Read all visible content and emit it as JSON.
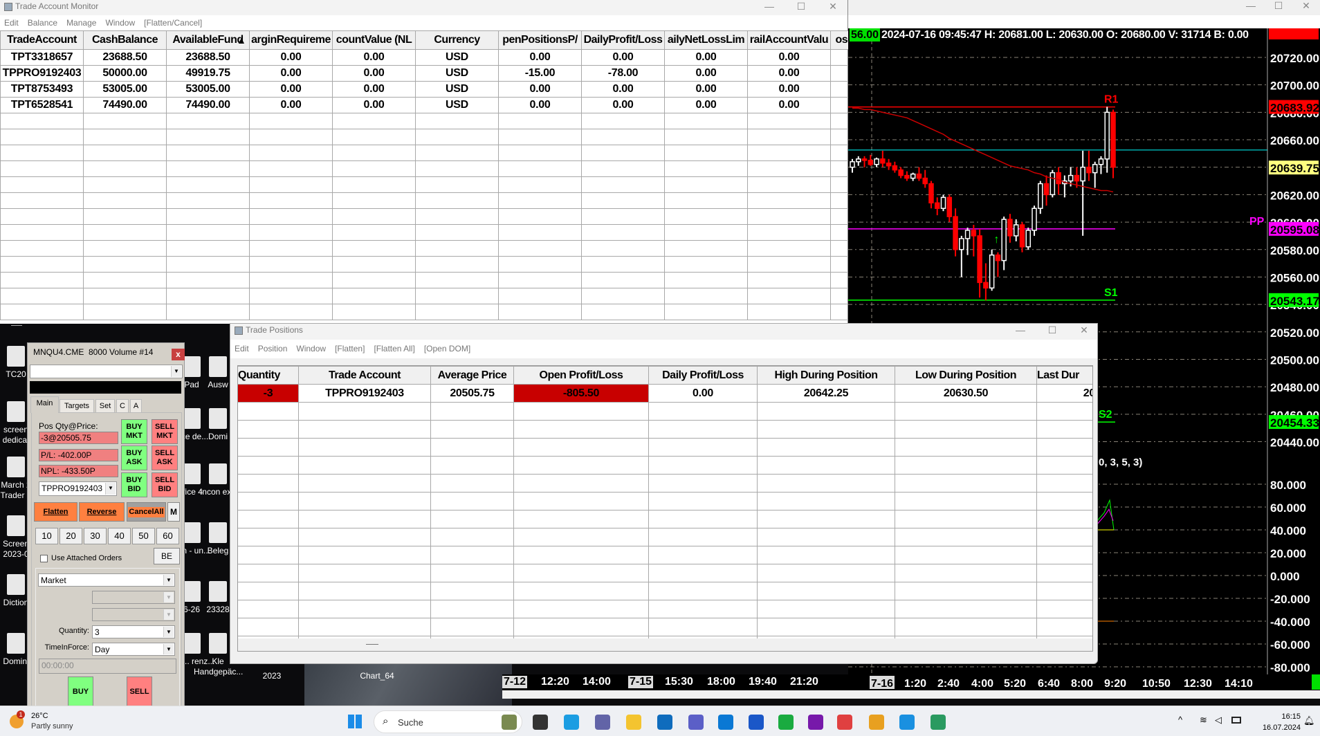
{
  "desktop": {
    "icons": [
      "TC20",
      "screen dedicat",
      "March 2 Trader o",
      "Screen 2023-0",
      "Diction",
      "Domini",
      "Pad",
      "Ausw",
      "ffice de...",
      "Domi",
      "ffice 4",
      "Incon exp",
      "pen - un...",
      "Beleg",
      "6-26",
      "23328",
      "reib... renz...",
      "Kle Handgepäc...",
      "2023",
      "Chart_64"
    ]
  },
  "account_monitor": {
    "title": "Trade Account Monitor",
    "menu": [
      "Edit",
      "Balance",
      "Manage",
      "Window",
      "[Flatten/Cancel]"
    ],
    "columns": [
      "TradeAccount",
      "CashBalance",
      "AvailableFund",
      "arginRequireme",
      "countValue (NL",
      "Currency",
      "penPositionsP/",
      "DailyProfit/Loss",
      "ailyNetLossLim",
      "railAccountValu",
      "ose"
    ],
    "rows": [
      [
        "TPT3318657",
        "23688.50",
        "23688.50",
        "0.00",
        "0.00",
        "USD",
        "0.00",
        "0.00",
        "0.00",
        "0.00",
        ""
      ],
      [
        "TPPRO9192403",
        "50000.00",
        "49919.75",
        "0.00",
        "0.00",
        "USD",
        "-15.00",
        "-78.00",
        "0.00",
        "0.00",
        ""
      ],
      [
        "TPT8753493",
        "53005.00",
        "53005.00",
        "0.00",
        "0.00",
        "USD",
        "0.00",
        "0.00",
        "0.00",
        "0.00",
        ""
      ],
      [
        "TPT6528541",
        "74490.00",
        "74490.00",
        "0.00",
        "0.00",
        "USD",
        "0.00",
        "0.00",
        "0.00",
        "0.00",
        ""
      ]
    ]
  },
  "chart": {
    "last_badge": "56.00",
    "info": "2024-07-16 09:45:47 H: 20681.00 L: 20630.00 O: 20680.00 V: 31714 B: 0.00",
    "study_label": "0, 3, 5, 3)",
    "colors": {
      "up": "#ffffff",
      "down": "#ff0000",
      "r1": "#ff0000",
      "pp": "#ff00ff",
      "s": "#00ff00",
      "cyan": "#00ffff",
      "ma": "#cc0000"
    }
  },
  "chart_data": {
    "type": "candlestick",
    "price_ticks": [
      20720,
      20700,
      20680,
      20660,
      20640,
      20620,
      20600,
      20580,
      20560,
      20540,
      20520,
      20500,
      20480,
      20460,
      20440
    ],
    "price_tick_labels": [
      "20720.00",
      "20700.00",
      "20680.00",
      "20660.00",
      "20640.00",
      "20620.00",
      "20600.00",
      "20580.00",
      "20560.00",
      "20540.00",
      "20520.00",
      "20500.00",
      "20480.00",
      "20460.00",
      "20440.00"
    ],
    "indicator_ticks": [
      "80.000",
      "60.000",
      "40.000",
      "20.000",
      "0.000",
      "-20.000",
      "-40.000",
      "-60.000",
      "-80.000"
    ],
    "time_labels": [
      {
        "t": "7-12",
        "box": true
      },
      {
        "t": "12:20"
      },
      {
        "t": "14:00"
      },
      {
        "t": "7-15",
        "box": true
      },
      {
        "t": "15:30"
      },
      {
        "t": "18:00"
      },
      {
        "t": "19:40"
      },
      {
        "t": "21:20"
      },
      {
        "t": "7-16",
        "box": true
      },
      {
        "t": "1:20"
      },
      {
        "t": "2:40"
      },
      {
        "t": "4:00"
      },
      {
        "t": "5:20"
      },
      {
        "t": "6:40"
      },
      {
        "t": "8:00"
      },
      {
        "t": "9:20"
      },
      {
        "t": "10:50"
      },
      {
        "t": "12:30"
      },
      {
        "t": "14:10"
      }
    ],
    "levels": [
      {
        "name": "R1",
        "value": 20683.92,
        "label": "20683.92",
        "color": "#ff0000",
        "text": "#000"
      },
      {
        "name": "PP",
        "value": 20595.08,
        "label": "20595.08",
        "color": "#ff00ff",
        "text": "#000"
      },
      {
        "name": "S1",
        "value": 20543.17,
        "label": "20543.17",
        "color": "#00ff00",
        "text": "#000"
      },
      {
        "name": "S2",
        "value": 20454.33,
        "label": "20454.33",
        "color": "#00ff00",
        "text": "#000"
      }
    ],
    "current_price": {
      "value": 20639.75,
      "label": "20639.75"
    },
    "cyan_line": 20652.5,
    "candles": [
      [
        20640,
        20646,
        20636,
        20644
      ],
      [
        20644,
        20648,
        20641,
        20646
      ],
      [
        20646,
        20648,
        20640,
        20645
      ],
      [
        20645,
        20649,
        20641,
        20642
      ],
      [
        20642,
        20647,
        20640,
        20646
      ],
      [
        20646,
        20652,
        20640,
        20643
      ],
      [
        20643,
        20646,
        20638,
        20641
      ],
      [
        20641,
        20644,
        20636,
        20638
      ],
      [
        20638,
        20640,
        20632,
        20634
      ],
      [
        20634,
        20637,
        20630,
        20632
      ],
      [
        20632,
        20636,
        20630,
        20635
      ],
      [
        20635,
        20640,
        20630,
        20632
      ],
      [
        20632,
        20638,
        20625,
        20628
      ],
      [
        20628,
        20630,
        20610,
        20614
      ],
      [
        20614,
        20618,
        20605,
        20610
      ],
      [
        20610,
        20620,
        20608,
        20618
      ],
      [
        20618,
        20620,
        20600,
        20604
      ],
      [
        20604,
        20610,
        20575,
        20580
      ],
      [
        20580,
        20590,
        20560,
        20588
      ],
      [
        20588,
        20596,
        20576,
        20594
      ],
      [
        20594,
        20598,
        20575,
        20590
      ],
      [
        20590,
        20595,
        20545,
        20556
      ],
      [
        20556,
        20570,
        20543,
        20552
      ],
      [
        20552,
        20580,
        20550,
        20576
      ],
      [
        20576,
        20578,
        20560,
        20572
      ],
      [
        20572,
        20604,
        20565,
        20602
      ],
      [
        20602,
        20606,
        20585,
        20590
      ],
      [
        20590,
        20602,
        20586,
        20598
      ],
      [
        20598,
        20600,
        20578,
        20582
      ],
      [
        20582,
        20596,
        20580,
        20594
      ],
      [
        20594,
        20612,
        20590,
        20610
      ],
      [
        20610,
        20630,
        20606,
        20628
      ],
      [
        20628,
        20634,
        20612,
        20620
      ],
      [
        20620,
        20638,
        20618,
        20636
      ],
      [
        20636,
        20640,
        20620,
        20628
      ],
      [
        20628,
        20634,
        20618,
        20630
      ],
      [
        20630,
        20640,
        20626,
        20634
      ],
      [
        20634,
        20640,
        20625,
        20630
      ],
      [
        20630,
        20652,
        20590,
        20640
      ],
      [
        20640,
        20652,
        20630,
        20636
      ],
      [
        20636,
        20644,
        20625,
        20642
      ],
      [
        20642,
        20648,
        20635,
        20646
      ],
      [
        20646,
        20684,
        20636,
        20680
      ],
      [
        20680,
        20682,
        20632,
        20640
      ]
    ],
    "ma": [
      20683,
      20683,
      20682,
      20682,
      20681,
      20680,
      20679,
      20678,
      20677,
      20676,
      20674,
      20672,
      20670,
      20668,
      20666,
      20664,
      20661,
      20659,
      20657,
      20655,
      20653,
      20651,
      20649,
      20647,
      20645,
      20643,
      20641,
      20640,
      20639,
      20638,
      20636,
      20635,
      20633,
      20632,
      20631,
      20629,
      20628,
      20627,
      20626,
      20625,
      20624,
      20623,
      20623,
      20622
    ]
  },
  "positions": {
    "title": "Trade Positions",
    "menu": [
      "Edit",
      "Position",
      "Window",
      "[Flatten]",
      "[Flatten All]",
      "[Open DOM]"
    ],
    "columns": [
      "Quantity",
      "Trade Account",
      "Average Price",
      "Open Profit/Loss",
      "Daily Profit/Loss",
      "High During Position",
      "Low During Position",
      "Last Dur"
    ],
    "rows": [
      [
        "-3",
        "TPPRO9192403",
        "20505.75",
        "-805.50",
        "0.00",
        "20642.25",
        "20630.50",
        "20"
      ]
    ],
    "loss_color": "#c80000"
  },
  "dom": {
    "title": "MNQU4.CME  8000 Volume #14",
    "close": "x",
    "tabs": [
      "Main",
      "Targets",
      "Set",
      "C",
      "A"
    ],
    "pos_label": "Pos Qty@Price:",
    "pos_value": "-3@20505.75",
    "pl": "P/L: -402.00P",
    "npl": "NPL: -433.50P",
    "account": "TPPRO9192403",
    "buy_mkt": [
      "BUY",
      "MKT"
    ],
    "sell_mkt": [
      "SELL",
      "MKT"
    ],
    "buy_ask": [
      "BUY",
      "ASK"
    ],
    "sell_ask": [
      "SELL",
      "ASK"
    ],
    "buy_bid": [
      "BUY",
      "BID"
    ],
    "sell_bid": [
      "SELL",
      "BID"
    ],
    "flatten": "Flatten",
    "reverse": "Reverse",
    "cancel_all": "CancelAll",
    "m": "M",
    "qty_presets": [
      "10",
      "20",
      "30",
      "40",
      "50",
      "60"
    ],
    "use_attached": "Use Attached Orders",
    "use_attached_checked": false,
    "be": "BE",
    "order_type": "Market",
    "quantity_label": "Quantity:",
    "quantity": "3",
    "tif_label": "TimeInForce:",
    "tif": "Day",
    "time_placeholder": "00:00:00",
    "buy": "BUY",
    "sell": "SELL"
  },
  "taskbar": {
    "weather_temp": "26°C",
    "weather_text": "Partly sunny",
    "weather_badge": "1",
    "search": "Suche",
    "time": "16:15",
    "date": "16.07.2024"
  }
}
